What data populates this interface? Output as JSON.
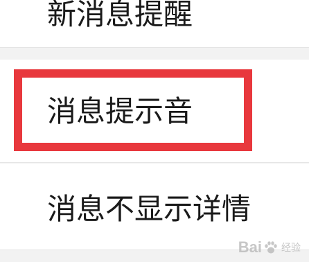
{
  "settings": {
    "items": [
      {
        "label": "新消息提醒"
      },
      {
        "label": "消息提示音"
      },
      {
        "label": "消息不显示详情"
      }
    ]
  },
  "annotation": {
    "highlight_color": "#e8383d"
  },
  "watermark": {
    "brand": "Bai",
    "brand_suffix": "经验",
    "icon": "paw-icon"
  }
}
